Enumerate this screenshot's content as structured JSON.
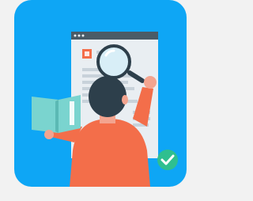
{
  "colors": {
    "tile_background": "#0ea6f5",
    "outer_background": "#f2f2f2",
    "browser_page": "#e9eef2",
    "browser_bar": "#4a5b66",
    "text_lines": "#c8d2da",
    "logo_accent": "#f36e4a",
    "shirt": "#f36e4a",
    "hair": "#2d3f4b",
    "skin": "#f3a48f",
    "book_cover": "#7ad4cf",
    "book_pages": "#ffffff",
    "magnifier_ring": "#2d3f4b",
    "magnifier_glass": "#d8eef7",
    "check_badge": "#2fbf8f",
    "check_mark": "#ffffff"
  },
  "icons": {
    "illustration": "person-researching-icon",
    "browser": "browser-window-icon",
    "magnifier": "magnifier-icon",
    "book": "open-book-icon",
    "check": "check-badge-icon",
    "logo": "logo-icon"
  }
}
